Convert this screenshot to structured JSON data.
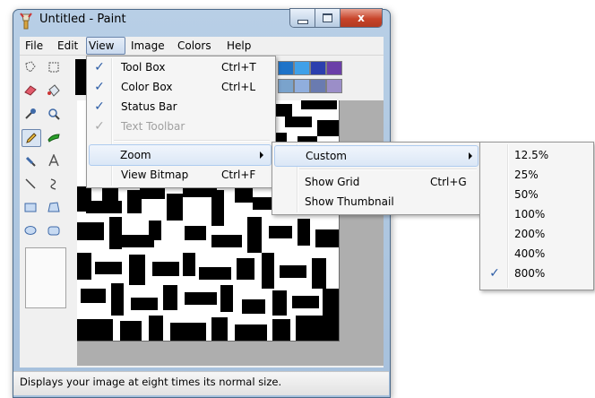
{
  "window": {
    "title": "Untitled - Paint",
    "close_glyph": "x"
  },
  "menubar": [
    "File",
    "Edit",
    "View",
    "Image",
    "Colors",
    "Help"
  ],
  "view_menu": [
    {
      "label": "Tool Box",
      "shortcut": "Ctrl+T",
      "checked": true
    },
    {
      "label": "Color Box",
      "shortcut": "Ctrl+L",
      "checked": true
    },
    {
      "label": "Status Bar",
      "shortcut": "",
      "checked": true
    },
    {
      "label": "Text Toolbar",
      "shortcut": "",
      "checked": true,
      "disabled": true
    },
    {
      "label": "Zoom",
      "shortcut": "",
      "submenu": true,
      "highlighted": true
    },
    {
      "label": "View Bitmap",
      "shortcut": "Ctrl+F"
    }
  ],
  "zoom_menu": [
    {
      "label": "Custom",
      "shortcut": "",
      "submenu": true,
      "highlighted": true
    },
    {
      "label": "Show Grid",
      "shortcut": "Ctrl+G"
    },
    {
      "label": "Show Thumbnail",
      "shortcut": ""
    }
  ],
  "custom_menu": {
    "options": [
      "12.5%",
      "25%",
      "50%",
      "100%",
      "200%",
      "400%",
      "800%"
    ],
    "selected": "800%"
  },
  "status": "Displays your image at eight times its normal size.",
  "palette": [
    "#1f73c8",
    "#3fa0e8",
    "#2c3fae",
    "#6b3fa8",
    "#7aa3cc",
    "#90aedd",
    "#6a7bb0",
    "#9b8ec8"
  ],
  "icons": [
    "paint-app-icon",
    "free-select-icon",
    "rect-select-icon",
    "eraser-icon",
    "fill-icon",
    "picker-icon",
    "magnifier-icon",
    "pencil-icon",
    "brush-icon",
    "airbrush-icon",
    "text-icon",
    "line-icon",
    "curve-icon",
    "rectangle-icon",
    "polygon-icon",
    "ellipse-icon",
    "rounded-rect-icon",
    "check-icon",
    "submenu-arrow-icon"
  ]
}
